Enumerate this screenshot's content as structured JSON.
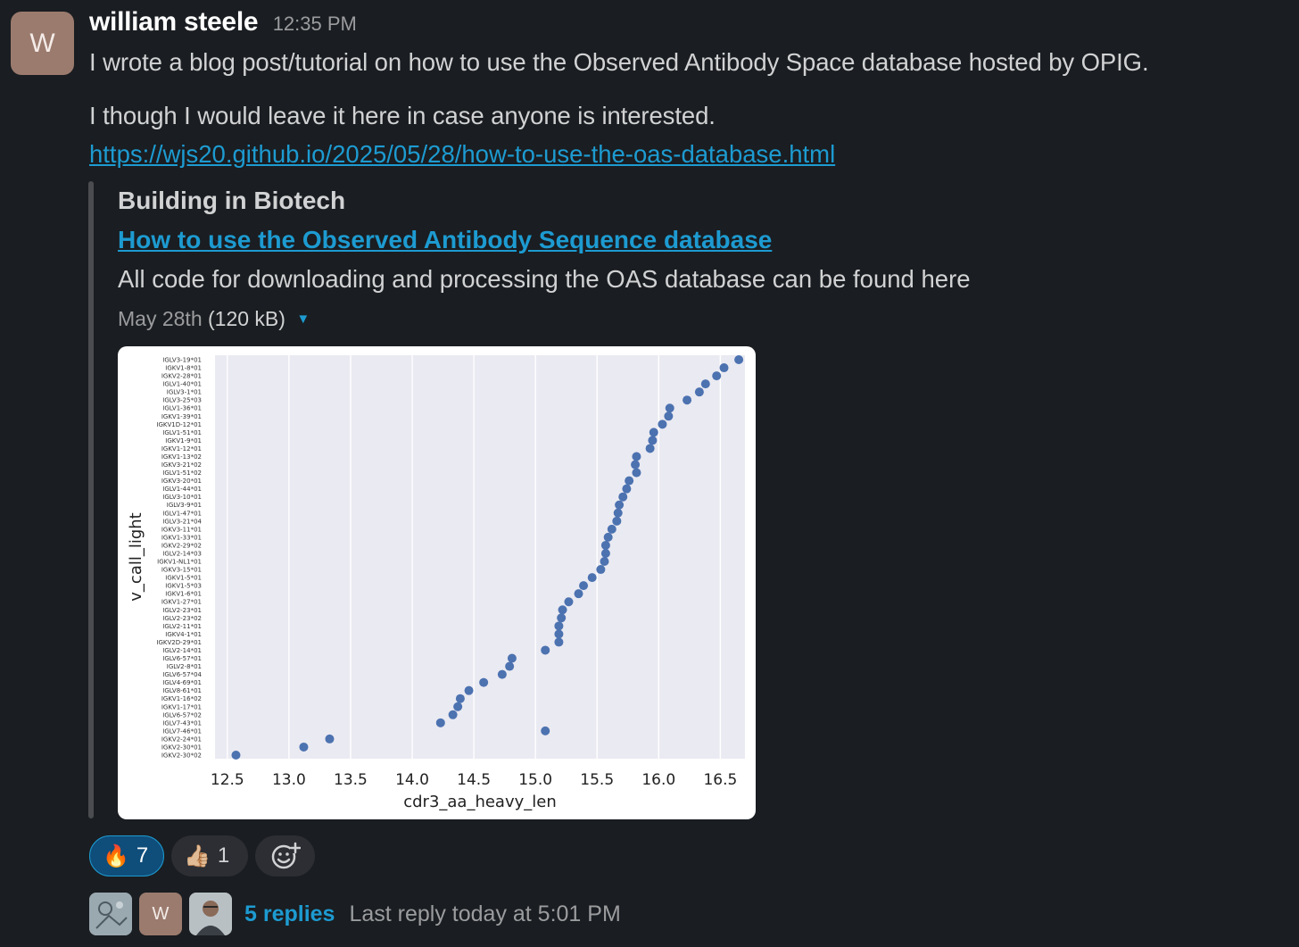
{
  "message": {
    "avatar_initial": "W",
    "author": "william steele",
    "timestamp": "12:35 PM",
    "line1": "I wrote a blog post/tutorial on how to use the Observed Antibody Space database hosted by OPIG.",
    "line2": "I though I would leave it here in case anyone is interested.",
    "link": "https://wjs20.github.io/2025/05/28/how-to-use-the-oas-database.html"
  },
  "unfurl": {
    "site_name": "Building in Biotech",
    "title": "How to use the Observed Antibody Sequence database",
    "description": "All code for downloading and processing the OAS database can be found here",
    "date": "May 28th",
    "size": "(120 kB)"
  },
  "chart_data": {
    "type": "scatter",
    "xlabel": "cdr3_aa_heavy_len",
    "ylabel": "v_call_light",
    "xlim": [
      12.4,
      16.7
    ],
    "xticks": [
      12.5,
      13.0,
      13.5,
      14.0,
      14.5,
      15.0,
      15.5,
      16.0,
      16.5
    ],
    "grid": "vertical",
    "background": "#eaeaf2",
    "point_color": "#4c72b0",
    "categories": [
      "IGLV3-19*01",
      "IGKV1-8*01",
      "IGKV2-28*01",
      "IGLV1-40*01",
      "IGLV3-1*01",
      "IGLV3-25*03",
      "IGLV1-36*01",
      "IGKV1-39*01",
      "IGKV1D-12*01",
      "IGLV1-51*01",
      "IGKV1-9*01",
      "IGKV1-12*01",
      "IGKV1-13*02",
      "IGKV3-21*02",
      "IGLV1-51*02",
      "IGKV3-20*01",
      "IGLV1-44*01",
      "IGLV3-10*01",
      "IGLV3-9*01",
      "IGLV1-47*01",
      "IGLV3-21*04",
      "IGKV3-11*01",
      "IGKV1-33*01",
      "IGKV2-29*02",
      "IGLV2-14*03",
      "IGKV1-NL1*01",
      "IGKV3-15*01",
      "IGKV1-5*01",
      "IGKV1-5*03",
      "IGKV1-6*01",
      "IGKV1-27*01",
      "IGLV2-23*01",
      "IGLV2-23*02",
      "IGLV2-11*01",
      "IGKV4-1*01",
      "IGKV2D-29*01",
      "IGLV2-14*01",
      "IGLV6-57*01",
      "IGLV2-8*01",
      "IGLV6-57*04",
      "IGLV4-69*01",
      "IGLV8-61*01",
      "IGKV1-16*02",
      "IGKV1-17*01",
      "IGLV6-57*02",
      "IGLV7-43*01",
      "IGLV7-46*01",
      "IGKV2-24*01",
      "IGKV2-30*01",
      "IGKV2-30*02"
    ],
    "values": [
      16.65,
      16.53,
      16.47,
      16.38,
      16.33,
      16.23,
      16.09,
      16.08,
      16.03,
      15.96,
      15.95,
      15.93,
      15.82,
      15.81,
      15.82,
      15.76,
      15.74,
      15.71,
      15.68,
      15.67,
      15.66,
      15.62,
      15.59,
      15.57,
      15.57,
      15.56,
      15.53,
      15.46,
      15.39,
      15.35,
      15.27,
      15.22,
      15.21,
      15.19,
      15.19,
      15.19,
      15.08,
      14.81,
      14.79,
      14.73,
      14.58,
      14.46,
      14.39,
      14.37,
      14.33,
      14.23,
      15.08,
      13.33,
      13.12,
      12.57
    ]
  },
  "reactions": [
    {
      "emoji": "🔥",
      "count": "7"
    },
    {
      "emoji": "👍🏼",
      "count": "1"
    }
  ],
  "thread": {
    "avatar2_initial": "W",
    "replies": "5 replies",
    "last_reply": "Last reply today at 5:01 PM"
  }
}
